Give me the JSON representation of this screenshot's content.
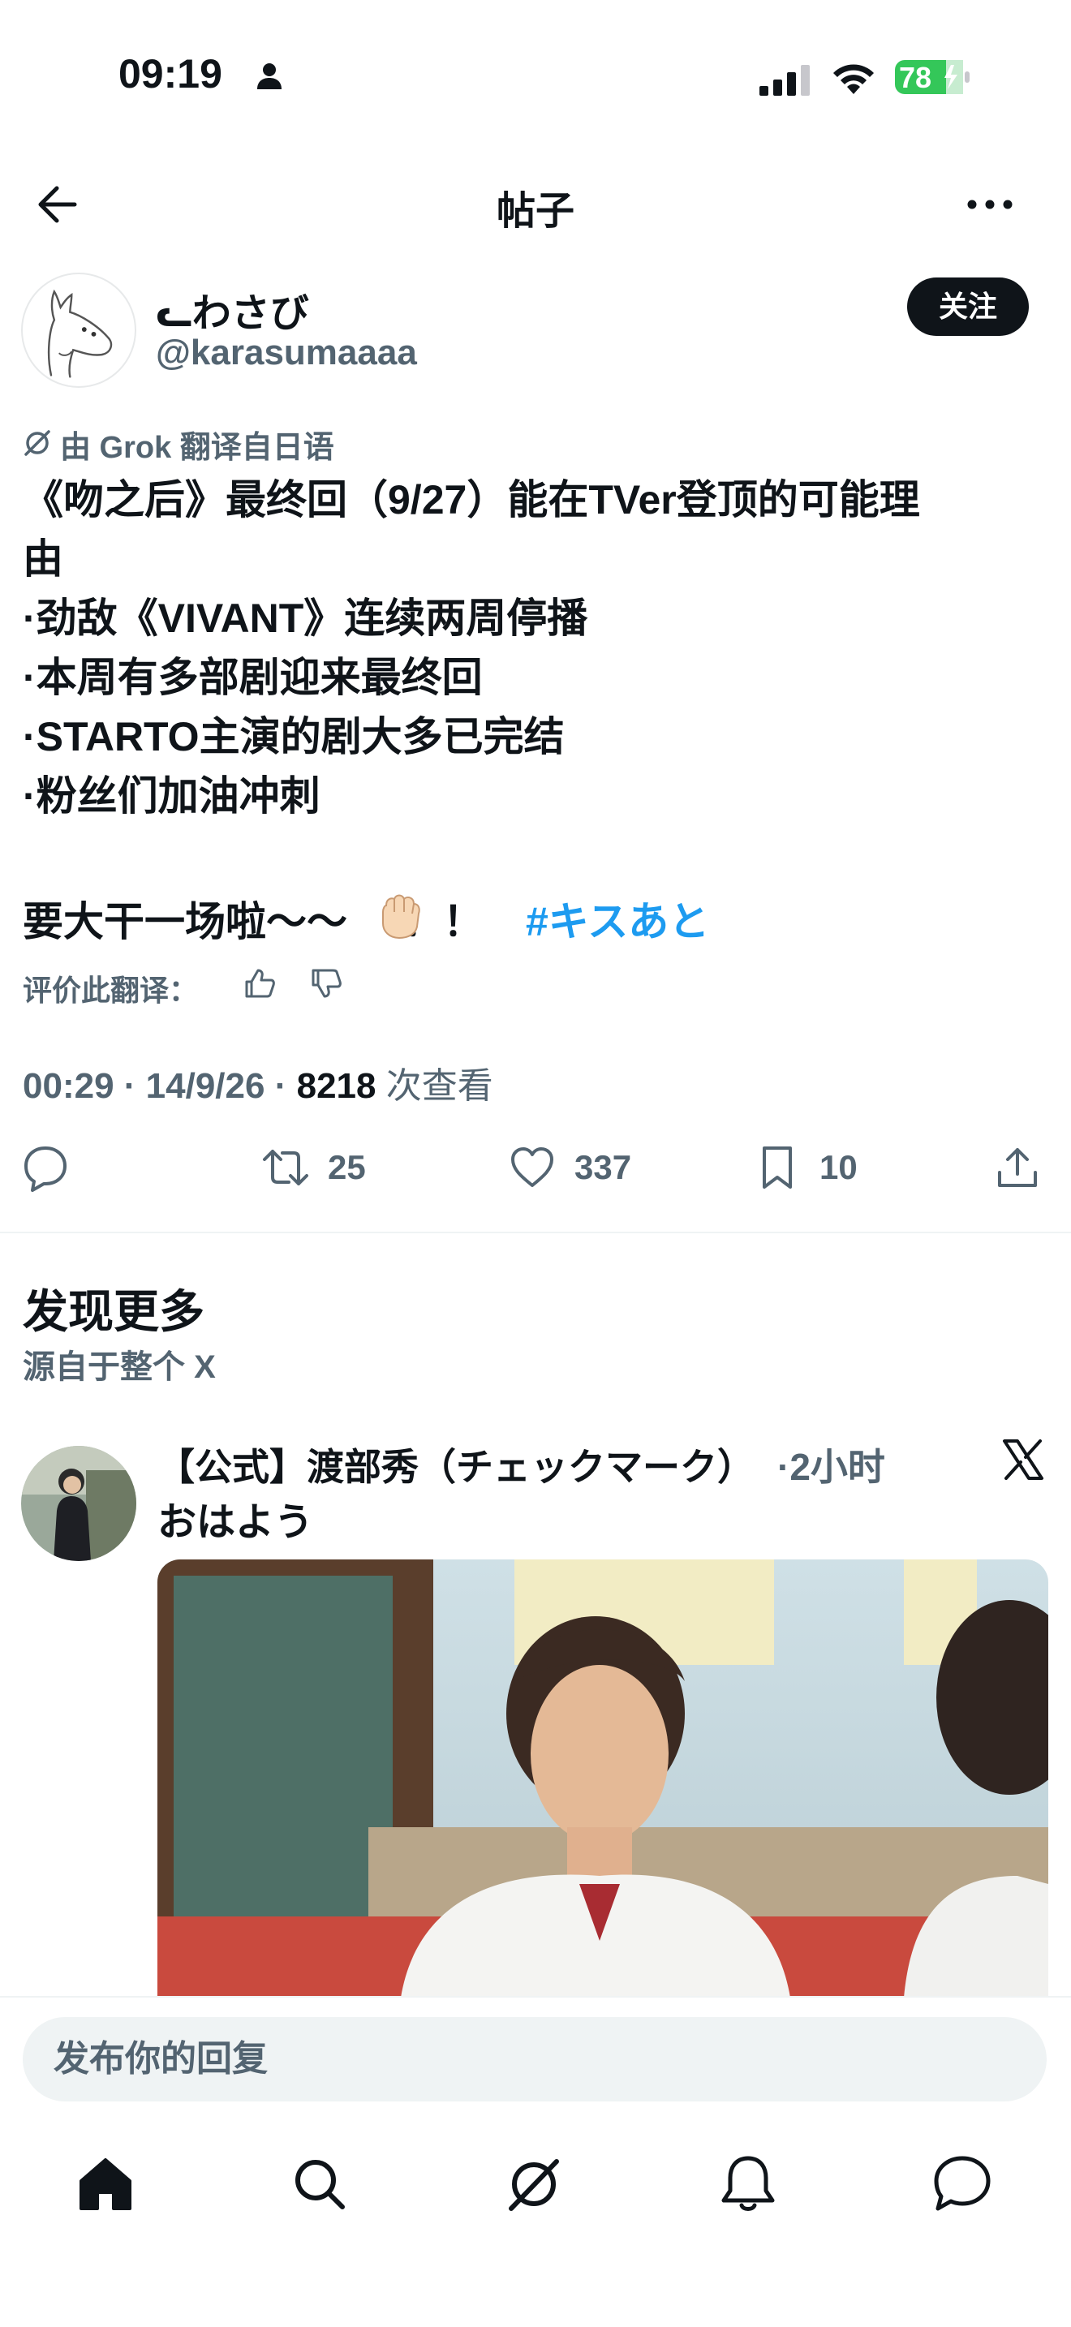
{
  "status_bar": {
    "time": "09:19",
    "battery": "78"
  },
  "header": {
    "title": "帖子"
  },
  "author": {
    "name": "ᓚわさび",
    "handle": "@karasumaaaa",
    "follow_label": "关注"
  },
  "translation": {
    "label": "由 Grok 翻译自日语"
  },
  "post": {
    "lines": [
      "《吻之后》最终回（9/27）能在TVer登顶的可能理",
      "由",
      "·劲敌《VIVANT》连续两周停播",
      "·本周有多部剧迎来最终回",
      "·STARTO主演的剧大多已完结",
      "·粉丝们加油冲刺"
    ],
    "closing_text": "要大干一场啦～～",
    "closing_marks": "！！",
    "hashtag": "#キスあと"
  },
  "rate_translation": {
    "label": "评价此翻译："
  },
  "meta": {
    "time": "00:29",
    "date": "14/9/26",
    "views_count": "8218",
    "views_label": "次查看"
  },
  "actions": {
    "retweets": "25",
    "likes": "337",
    "bookmarks": "10"
  },
  "discover": {
    "title": "发现更多",
    "subtitle": "源自于整个 X"
  },
  "recommended": {
    "name": "【公式】渡部秀（チェックマーク）",
    "time": "·2小时",
    "text": "おはよう"
  },
  "composer": {
    "placeholder": "发布你的回复"
  },
  "colors": {
    "accent": "#1d9bf0",
    "text": "#0f1419",
    "muted": "#536471",
    "battery": "#34c759"
  }
}
